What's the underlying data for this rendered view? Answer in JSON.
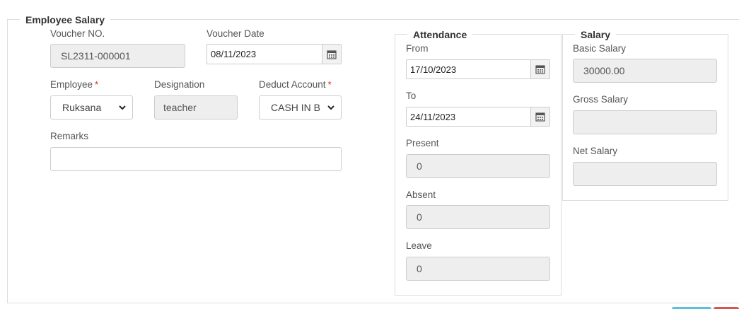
{
  "employee_salary": {
    "legend": "Employee Salary",
    "voucher_no": {
      "label": "Voucher NO.",
      "value": "SL2311-000001"
    },
    "voucher_date": {
      "label": "Voucher Date",
      "value": "08/11/2023"
    },
    "employee": {
      "label": "Employee",
      "required_mark": "*",
      "value": "Ruksana"
    },
    "designation": {
      "label": "Designation",
      "value": "teacher"
    },
    "deduct_account": {
      "label": "Deduct Account",
      "required_mark": "*",
      "value": "CASH IN B"
    },
    "remarks": {
      "label": "Remarks",
      "value": ""
    }
  },
  "attendance": {
    "legend": "Attendance",
    "from": {
      "label": "From",
      "value": "17/10/2023"
    },
    "to": {
      "label": "To",
      "value": "24/11/2023"
    },
    "present": {
      "label": "Present",
      "value": "0"
    },
    "absent": {
      "label": "Absent",
      "value": "0"
    },
    "leave": {
      "label": "Leave",
      "value": "0"
    }
  },
  "salary": {
    "legend": "Salary",
    "basic": {
      "label": "Basic Salary",
      "value": "30000.00"
    },
    "gross": {
      "label": "Gross Salary",
      "value": ""
    },
    "net": {
      "label": "Net Salary",
      "value": ""
    }
  },
  "icons": {
    "calendar": "calendar-icon",
    "dropdown": "chevron-down-icon"
  },
  "colors": {
    "required": "#d9261c",
    "button_info": "#5bc0de",
    "button_danger": "#d9534f"
  }
}
